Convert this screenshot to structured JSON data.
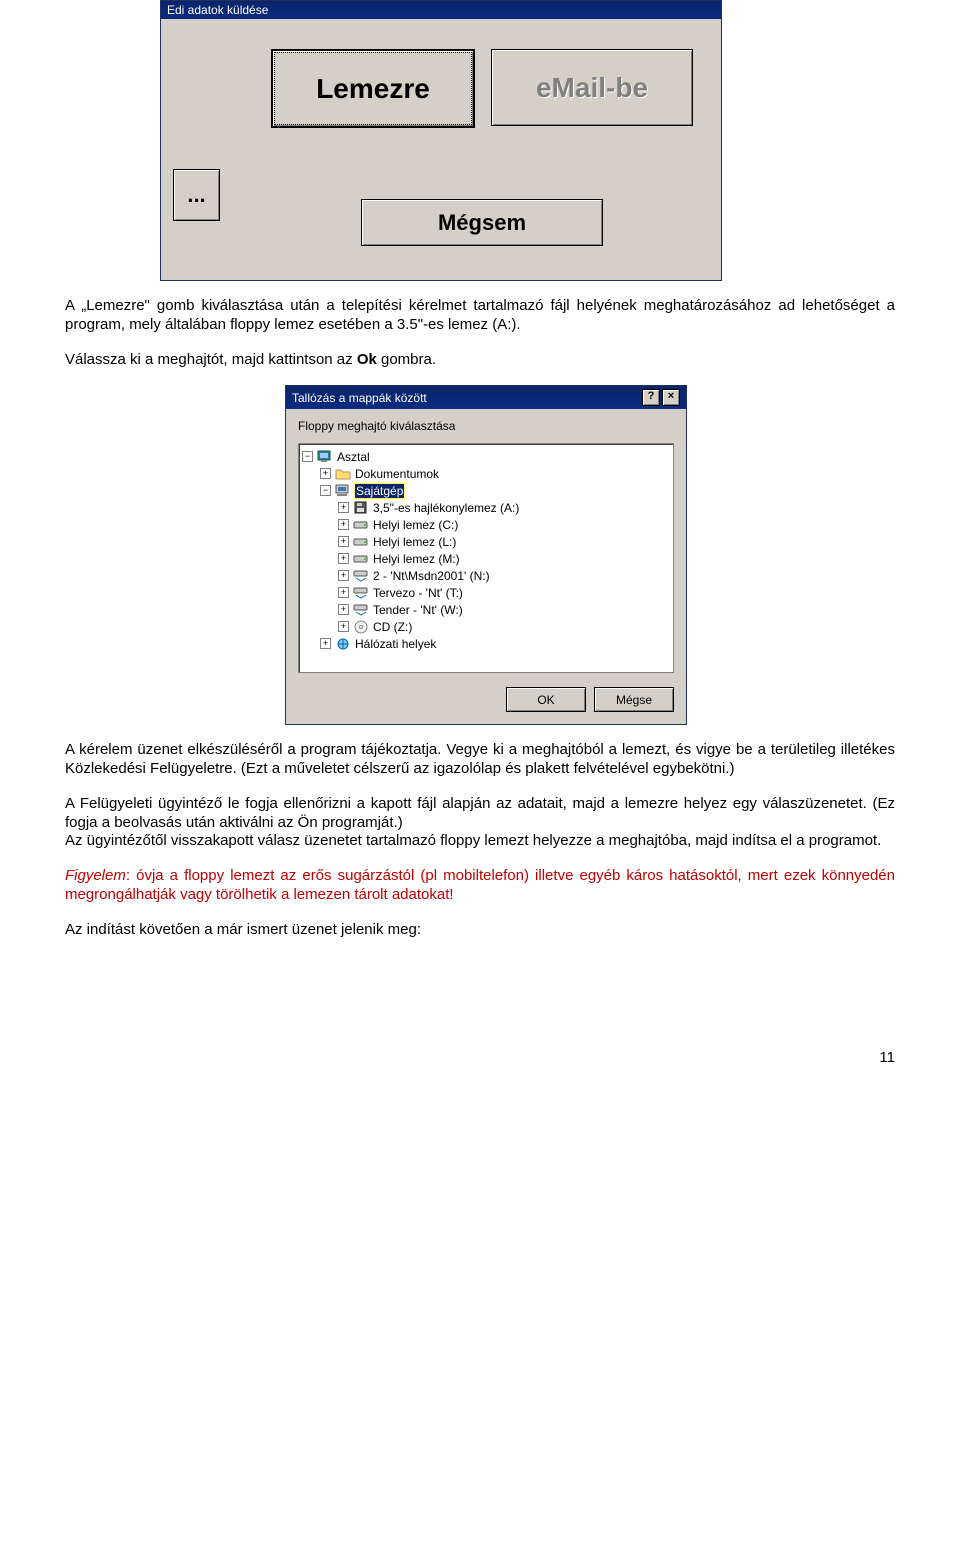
{
  "dialog1": {
    "title": "Edi adatok küldése",
    "btn_lemezre": "Lemezre",
    "btn_email": "eMail-be",
    "btn_dots": "...",
    "btn_megsem": "Mégsem"
  },
  "para1": "A „Lemezre\" gomb kiválasztása után a telepítési kérelmet tartalmazó fájl helyének meghatározásához ad lehetőséget a program, mely általában floppy lemez esetében a 3.5\"-es lemez (A:).",
  "para2_a": "Válassza ki a meghajtót, majd kattintson az ",
  "para2_b": "Ok",
  "para2_c": " gombra.",
  "dialog2": {
    "title": "Tallózás a mappák között",
    "help": "?",
    "close": "×",
    "prompt": "Floppy meghajtó kiválasztása",
    "ok": "OK",
    "cancel": "Mégse",
    "tree": [
      {
        "indent": 0,
        "exp": "−",
        "icon": "desktop",
        "label": "Asztal",
        "sel": false
      },
      {
        "indent": 1,
        "exp": "+",
        "icon": "folder",
        "label": "Dokumentumok",
        "sel": false
      },
      {
        "indent": 1,
        "exp": "−",
        "icon": "computer",
        "label": "Sajátgép",
        "sel": true
      },
      {
        "indent": 2,
        "exp": "+",
        "icon": "floppy",
        "label": "3,5\"-es hajlékonylemez (A:)",
        "sel": false
      },
      {
        "indent": 2,
        "exp": "+",
        "icon": "hdd",
        "label": "Helyi lemez (C:)",
        "sel": false
      },
      {
        "indent": 2,
        "exp": "+",
        "icon": "hdd",
        "label": "Helyi lemez (L:)",
        "sel": false
      },
      {
        "indent": 2,
        "exp": "+",
        "icon": "hdd",
        "label": "Helyi lemez (M:)",
        "sel": false
      },
      {
        "indent": 2,
        "exp": "+",
        "icon": "netdrive",
        "label": "2 - 'Nt\\Msdn2001' (N:)",
        "sel": false
      },
      {
        "indent": 2,
        "exp": "+",
        "icon": "netdrive",
        "label": "Tervezo - 'Nt' (T:)",
        "sel": false
      },
      {
        "indent": 2,
        "exp": "+",
        "icon": "netdrive",
        "label": "Tender - 'Nt' (W:)",
        "sel": false
      },
      {
        "indent": 2,
        "exp": "+",
        "icon": "cd",
        "label": "CD (Z:)",
        "sel": false
      },
      {
        "indent": 1,
        "exp": "+",
        "icon": "network",
        "label": "Hálózati helyek",
        "sel": false
      }
    ]
  },
  "para3": "A kérelem üzenet elkészüléséről a program tájékoztatja. Vegye ki a meghajtóból a lemezt, és vigye be a területileg illetékes Közlekedési Felügyeletre. (Ezt a műveletet célszerű az igazolólap és plakett felvételével egybekötni.)",
  "para4": "A Felügyeleti ügyintéző le fogja ellenőrizni a kapott fájl alapján az adatait, majd a lemezre helyez egy válaszüzenetet. (Ez fogja a beolvasás után aktiválni az Ön programját.)\nAz ügyintézőtől visszakapott válasz üzenetet tartalmazó floppy lemezt helyezze a meghajtóba, majd indítsa el a programot.",
  "para5_a": "Figyelem",
  "para5_b": ": óvja a floppy lemezt az erős sugárzástól (pl mobiltelefon) illetve egyéb káros hatásoktól, mert ezek könnyedén megrongálhatják vagy törölhetik a lemezen tárolt adatokat!",
  "para6": "Az indítást követően a már ismert üzenet jelenik meg:",
  "page_no": "11"
}
